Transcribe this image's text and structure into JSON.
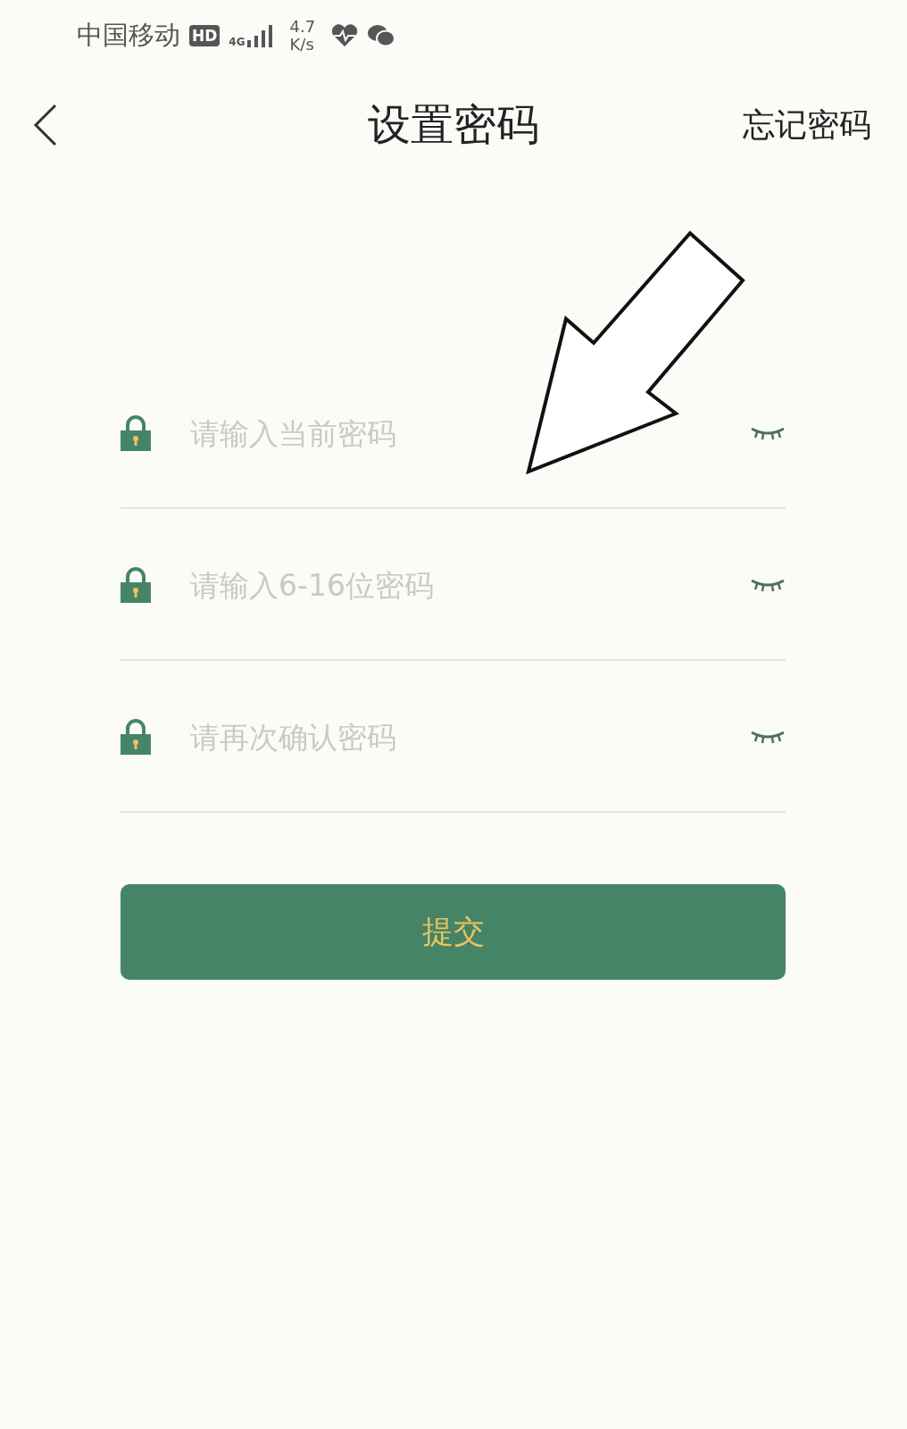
{
  "status_bar": {
    "carrier": "中国移动",
    "hd_badge": "HD",
    "network": "4G",
    "speed": "4.7",
    "speed_unit": "K/s"
  },
  "header": {
    "title": "设置密码",
    "action": "忘记密码"
  },
  "fields": [
    {
      "placeholder": "请输入当前密码"
    },
    {
      "placeholder": "请输入6-16位密码"
    },
    {
      "placeholder": "请再次确认密码"
    }
  ],
  "submit_button": "提交"
}
